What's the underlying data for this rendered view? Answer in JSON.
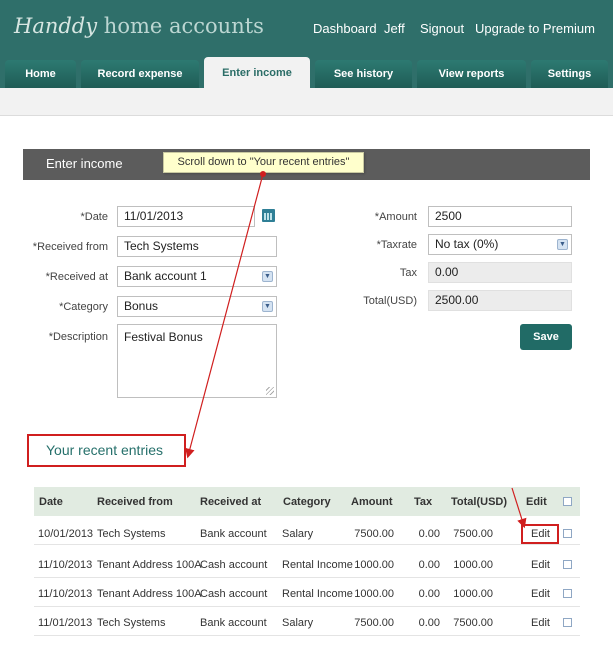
{
  "app": {
    "logo_script": "Handdy",
    "logo_rest": "home accounts"
  },
  "topnav": {
    "dashboard": "Dashboard",
    "user": "Jeff",
    "signout": "Signout",
    "premium": "Upgrade to Premium"
  },
  "tabs": {
    "home": "Home",
    "record_expense": "Record expense",
    "enter_income": "Enter income",
    "see_history": "See history",
    "view_reports": "View reports",
    "settings": "Settings"
  },
  "form": {
    "title": "Enter income",
    "tooltip": "Scroll down to \"Your recent entries\"",
    "date_label": "*Date",
    "date_value": "11/01/2013",
    "received_from_label": "*Received from",
    "received_from_value": "Tech Systems",
    "received_at_label": "*Received at",
    "received_at_value": "Bank account 1",
    "category_label": "*Category",
    "category_value": "Bonus",
    "description_label": "*Description",
    "description_value": "Festival Bonus",
    "amount_label": "*Amount",
    "amount_value": "2500",
    "taxrate_label": "*Taxrate",
    "taxrate_value": "No tax (0%)",
    "tax_label": "Tax",
    "tax_value": "0.00",
    "total_label": "Total(USD)",
    "total_value": "2500.00",
    "save_label": "Save"
  },
  "recent": {
    "heading": "Your recent entries",
    "columns": {
      "date": "Date",
      "received_from": "Received from",
      "received_at": "Received at",
      "category": "Category",
      "amount": "Amount",
      "tax": "Tax",
      "total": "Total(USD)",
      "edit": "Edit"
    },
    "rows": [
      {
        "date": "10/01/2013",
        "from": "Tech Systems",
        "at": "Bank account",
        "category": "Salary",
        "amount": "7500.00",
        "tax": "0.00",
        "total": "7500.00",
        "edit": "Edit"
      },
      {
        "date": "11/10/2013",
        "from": "Tenant Address 100A",
        "at": "Cash account",
        "category": "Rental Income",
        "amount": "1000.00",
        "tax": "0.00",
        "total": "1000.00",
        "edit": "Edit"
      },
      {
        "date": "11/10/2013",
        "from": "Tenant Address 100A",
        "at": "Cash account",
        "category": "Rental Income",
        "amount": "1000.00",
        "tax": "0.00",
        "total": "1000.00",
        "edit": "Edit"
      },
      {
        "date": "11/01/2013",
        "from": "Tech Systems",
        "at": "Bank account",
        "category": "Salary",
        "amount": "7500.00",
        "tax": "0.00",
        "total": "7500.00",
        "edit": "Edit"
      }
    ]
  },
  "colors": {
    "brand": "#2f6f6a",
    "annotation": "#d01f1f"
  }
}
